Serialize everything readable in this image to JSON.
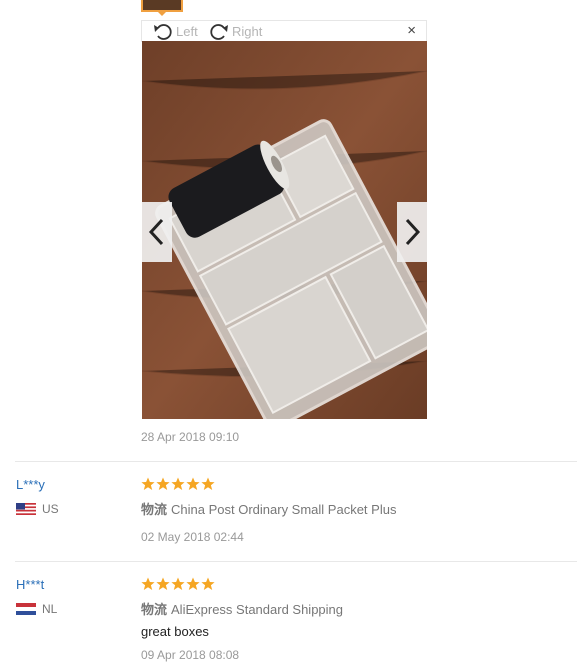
{
  "viewer": {
    "rotate_left_label": "Left",
    "rotate_right_label": "Right",
    "close_label": "×",
    "photo_date": "28 Apr 2018 09:10"
  },
  "reviews": [
    {
      "user": "L***y",
      "country": "US",
      "rating": 5,
      "shipping_label": "物流",
      "shipping_method": "China Post Ordinary Small Packet Plus",
      "feedback": "",
      "date": "02 May 2018 02:44"
    },
    {
      "user": "H***t",
      "country": "NL",
      "rating": 5,
      "shipping_label": "物流",
      "shipping_method": "AliExpress Standard Shipping",
      "feedback": "great boxes",
      "date": "09 Apr 2018 08:08"
    }
  ],
  "colors": {
    "accent_star": "#f5a623",
    "username": "#2a6fb8",
    "thumb_border": "#f0a040"
  }
}
